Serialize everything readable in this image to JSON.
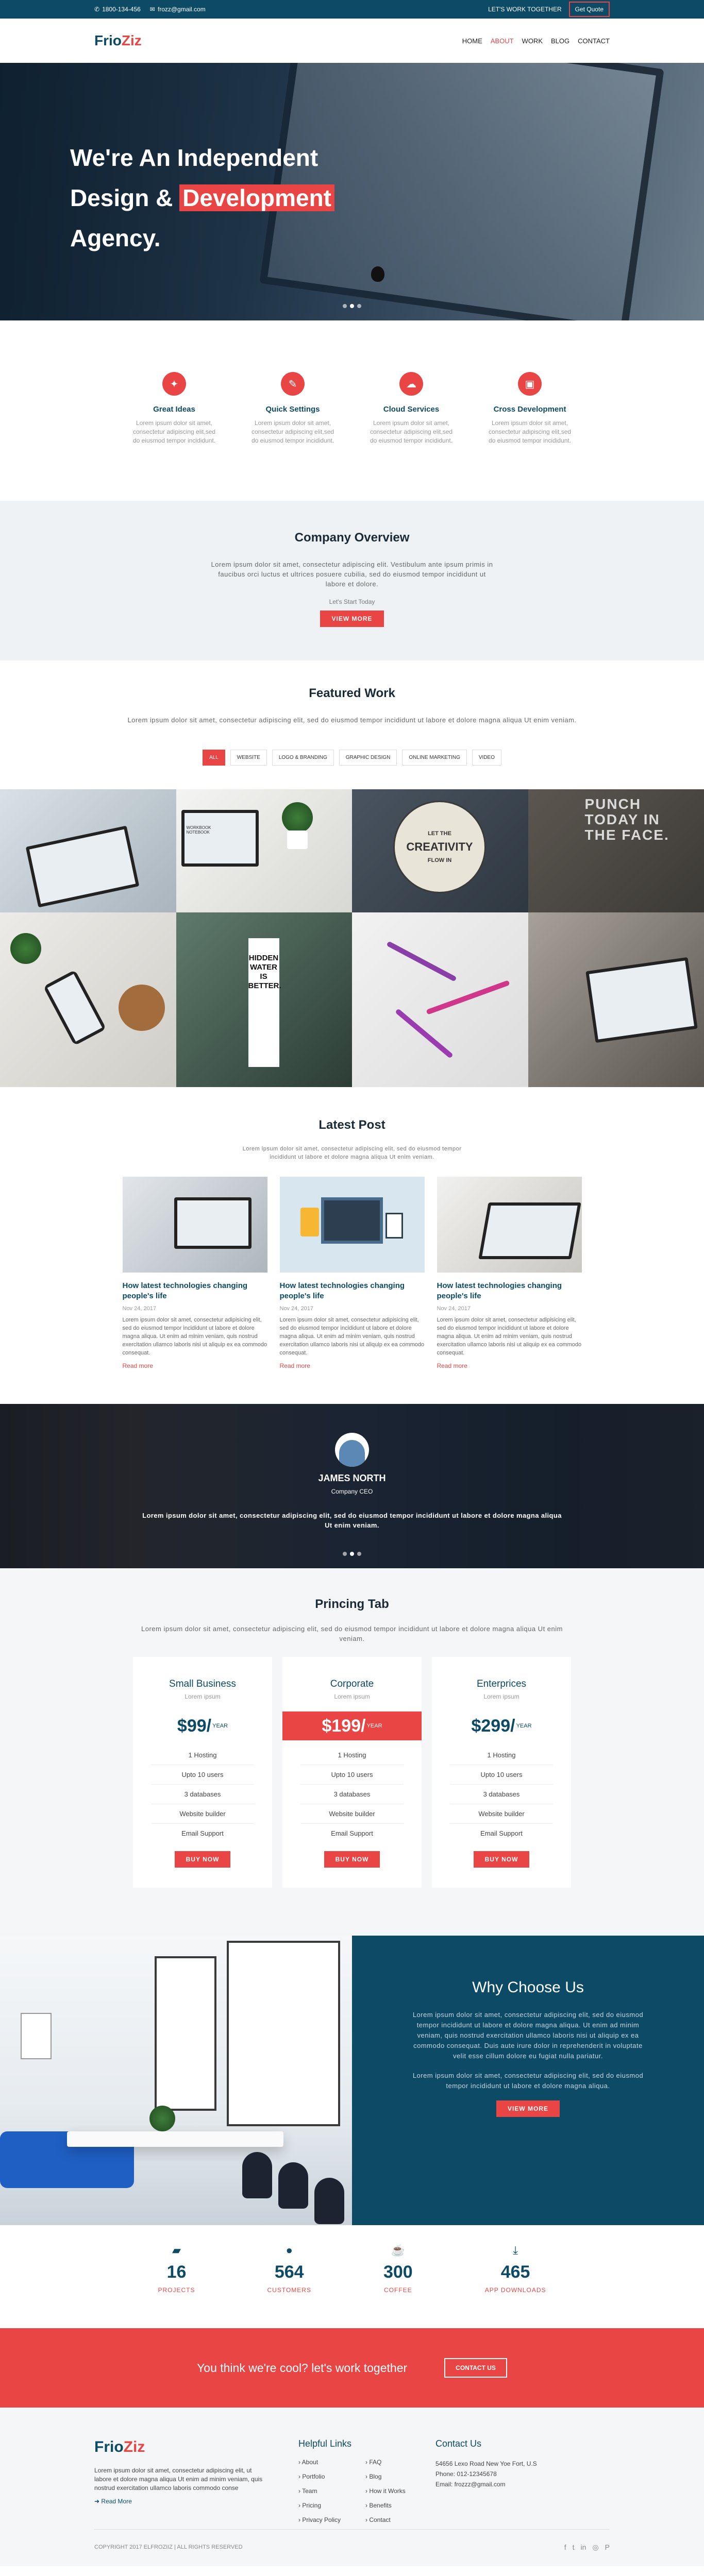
{
  "topbar": {
    "phone": "1800-134-456",
    "email": "frozz@gmail.com",
    "tagline": "LET'S WORK TOGETHER",
    "quote_button": "Get Quote"
  },
  "header": {
    "logo_part1": "Frio",
    "logo_part2": "Ziz",
    "nav": [
      {
        "label": "HOME"
      },
      {
        "label": "ABOUT"
      },
      {
        "label": "WORK"
      },
      {
        "label": "BLOG"
      },
      {
        "label": "CONTACT"
      }
    ],
    "active_nav": "ABOUT"
  },
  "hero": {
    "line1": "We're An Independent",
    "line2_a": "Design &",
    "line2_highlight": "Development",
    "line3": "Agency."
  },
  "features": [
    {
      "icon": "lightbulb-icon",
      "title": "Great Ideas",
      "text": "Lorem ipsum dolor sit amet, consectetur adipiscing elit,sed do eiusmod tempor incididunt."
    },
    {
      "icon": "wrench-icon",
      "title": "Quick Settings",
      "text": "Lorem ipsum dolor sit amet, consectetur adipiscing elit,sed do eiusmod tempor incididunt."
    },
    {
      "icon": "cloud-icon",
      "title": "Cloud Services",
      "text": "Lorem ipsum dolor sit amet, consectetur adipiscing elit,sed do eiusmod tempor incididunt."
    },
    {
      "icon": "desktop-icon",
      "title": "Cross Development",
      "text": "Lorem ipsum dolor sit amet, consectetur adipiscing elit,sed do eiusmod tempor incididunt."
    }
  ],
  "overview": {
    "title": "Company Overview",
    "text": "Lorem ipsum dolor sit amet, consectetur adipiscing elit. Vestibulum ante ipsum primis in faucibus orci luctus et ultrices posuere cubilia, sed do eiusmod tempor incididunt ut labore et dolore.",
    "sub": "Let's Start Today",
    "button": "VIEW MORE"
  },
  "featured": {
    "title": "Featured Work",
    "text": "Lorem ipsum dolor sit amet, consectetur adipiscing elit, sed do eiusmod tempor incididunt ut labore et dolore magna aliqua Ut enim veniam.",
    "filters": [
      "ALL",
      "WEBSITE",
      "LOGO & BRANDING",
      "GRAPHIC DESIGN",
      "ONLINE MARKETING",
      "VIDEO"
    ],
    "active_filter": "ALL",
    "gallery_words": {
      "creativity_line1": "LET THE",
      "creativity_line2": "CREATIVITY",
      "creativity_line3": "FLOW IN",
      "punch": "PUNCH TODAY IN THE FACE.",
      "hidden": "HIDDEN WATER IS BETTER.",
      "notebook": "WORKBOOK NOTEBOOK"
    }
  },
  "latest": {
    "title": "Latest Post",
    "intro": "Lorem ipsum dolor sit amet, consectetur adipiscing elit, sed do eiusmod tempor incididunt ut labore et dolore magna aliqua Ut enim veniam.",
    "posts": [
      {
        "title": "How latest technologies changing people's life",
        "date": "Nov 24, 2017",
        "text": "Lorem ipsum dolor sit amet, consectetur adipisicing elit, sed do eiusmod tempor incididunt ut labore et dolore magna aliqua. Ut enim ad minim veniam, quis nostrud exercitation ullamco laboris nisi ut aliquip ex ea commodo consequat.",
        "more": "Read more"
      },
      {
        "title": "How latest technologies changing people's life",
        "date": "Nov 24, 2017",
        "text": "Lorem ipsum dolor sit amet, consectetur adipisicing elit, sed do eiusmod tempor incididunt ut labore et dolore magna aliqua. Ut enim ad minim veniam, quis nostrud exercitation ullamco laboris nisi ut aliquip ex ea commodo consequat.",
        "more": "Read more"
      },
      {
        "title": "How latest technologies changing people's life",
        "date": "Nov 24, 2017",
        "text": "Lorem ipsum dolor sit amet, consectetur adipisicing elit, sed do eiusmod tempor incididunt ut labore et dolore magna aliqua. Ut enim ad minim veniam, quis nostrud exercitation ullamco laboris nisi ut aliquip ex ea commodo consequat.",
        "more": "Read more"
      }
    ]
  },
  "testimonial": {
    "name": "JAMES NORTH",
    "role": "Company CEO",
    "quote": "Lorem ipsum dolor sit amet, consectetur adipiscing elit, sed do eiusmod tempor incididunt ut labore et dolore magna aliqua Ut enim veniam."
  },
  "pricing": {
    "title": "Princing Tab",
    "intro": "Lorem ipsum dolor sit amet, consectetur adipiscing elit, sed do eiusmod tempor incididunt ut labore et dolore magna aliqua Ut enim veniam.",
    "plans": [
      {
        "name": "Small Business",
        "sub": "Lorem ipsum",
        "price": "$99/",
        "per": "YEAR",
        "features": [
          "1 Hosting",
          "Upto 10 users",
          "3 databases",
          "Website builder",
          "Email Support"
        ],
        "button": "BUY NOW"
      },
      {
        "name": "Corporate",
        "sub": "Lorem ipsum",
        "price": "$199/",
        "per": "YEAR",
        "features": [
          "1 Hosting",
          "Upto 10 users",
          "3 databases",
          "Website builder",
          "Email Support"
        ],
        "button": "BUY NOW"
      },
      {
        "name": "Enterprices",
        "sub": "Lorem ipsum",
        "price": "$299/",
        "per": "YEAR",
        "features": [
          "1 Hosting",
          "Upto 10 users",
          "3 databases",
          "Website builder",
          "Email Support"
        ],
        "button": "BUY NOW"
      }
    ]
  },
  "why": {
    "title": "Why Choose Us",
    "p1": "Lorem ipsum dolor sit amet, consectetur adipiscing elit, sed do eiusmod tempor incididunt ut labore et dolore magna aliqua. Ut enim ad minim veniam, quis nostrud exercitation ullamco laboris nisi ut aliquip ex ea commodo consequat. Duis aute irure dolor in reprehenderit in voluptate velit esse cillum dolore eu fugiat nulla pariatur.",
    "p2": "Lorem ipsum dolor sit amet, consectetur adipiscing elit, sed do eiusmod tempor incididunt ut labore et dolore magna aliqua.",
    "button": "VIEW MORE"
  },
  "stats": [
    {
      "icon": "briefcase-icon",
      "num": "16",
      "label": "PROJECTS"
    },
    {
      "icon": "user-icon",
      "num": "564",
      "label": "CUSTOMERS"
    },
    {
      "icon": "coffee-icon",
      "num": "300",
      "label": "COFFEE"
    },
    {
      "icon": "download-icon",
      "num": "465",
      "label": "APP DOWNLOADS"
    }
  ],
  "cta": {
    "text": "You think we're cool? let's work together",
    "button": "CONTACT US"
  },
  "footer": {
    "about": "Lorem ipsum dolor sit amet, consectetur adipiscing elit, ut labore et dolore magna aliqua Ut enim ad minim veniam, quis nostrud exercitation ullamco laboris commodo conse",
    "read_more": "Read More",
    "links_title": "Helpful Links",
    "links": [
      "About",
      "FAQ",
      "Portfolio",
      "Blog",
      "Team",
      "How it Works",
      "Pricing",
      "Benefits",
      "Privacy Policy",
      "Contact"
    ],
    "contact_title": "Contact Us",
    "address": "54656 Lexo Road New Yoe Fort, U.S",
    "phone": "Phone: 012-12345678",
    "email": "Email: frozzz@gmail.com",
    "copyright": "COPYRIGHT 2017 ELFROZIIZ | ALL RIGHTS RESERVED"
  },
  "colors": {
    "primary": "#0c4a66",
    "accent": "#e94545",
    "light_bg": "#eef2f4"
  }
}
